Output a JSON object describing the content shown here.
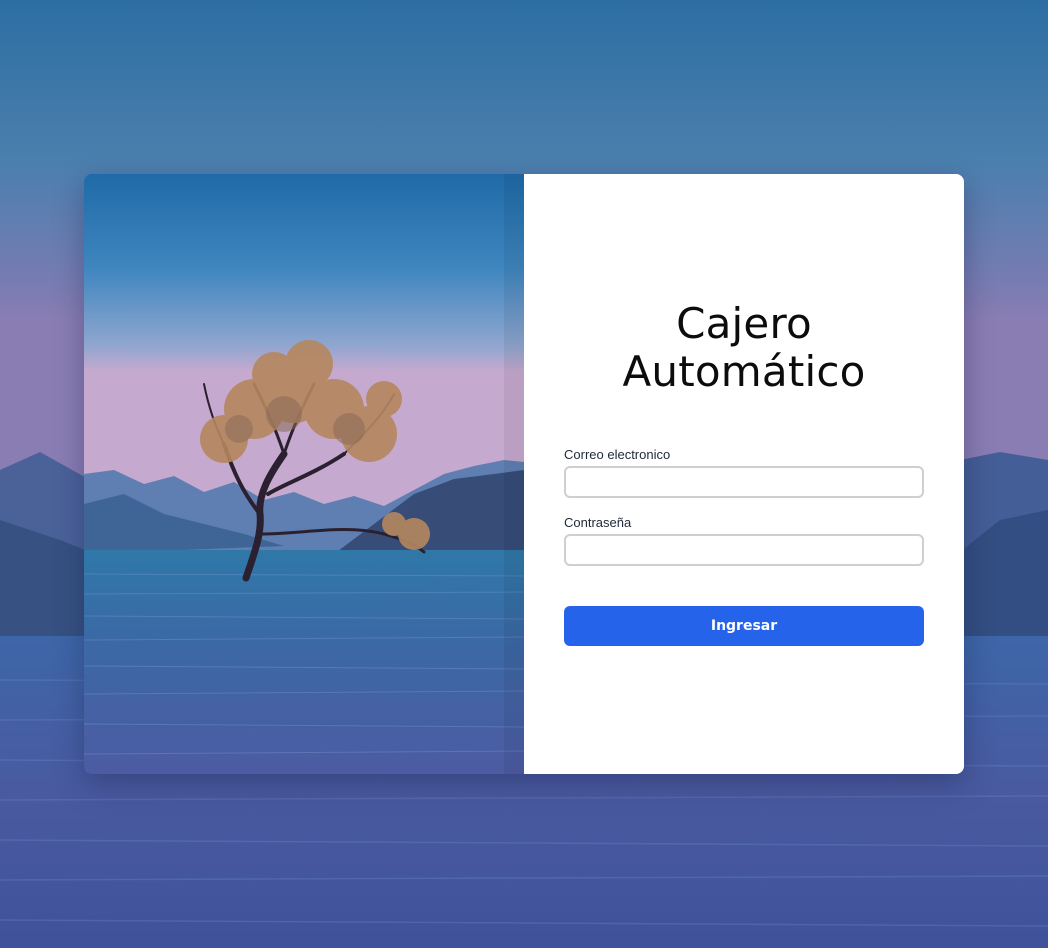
{
  "login": {
    "title_line1": "Cajero",
    "title_line2": "Automático",
    "email_label": "Correo electronico",
    "email_value": "",
    "password_label": "Contraseña",
    "password_value": "",
    "submit_label": "Ingresar"
  },
  "colors": {
    "accent": "#2563eb",
    "panel_bg": "#ffffff",
    "input_border": "#cfcfcf"
  }
}
